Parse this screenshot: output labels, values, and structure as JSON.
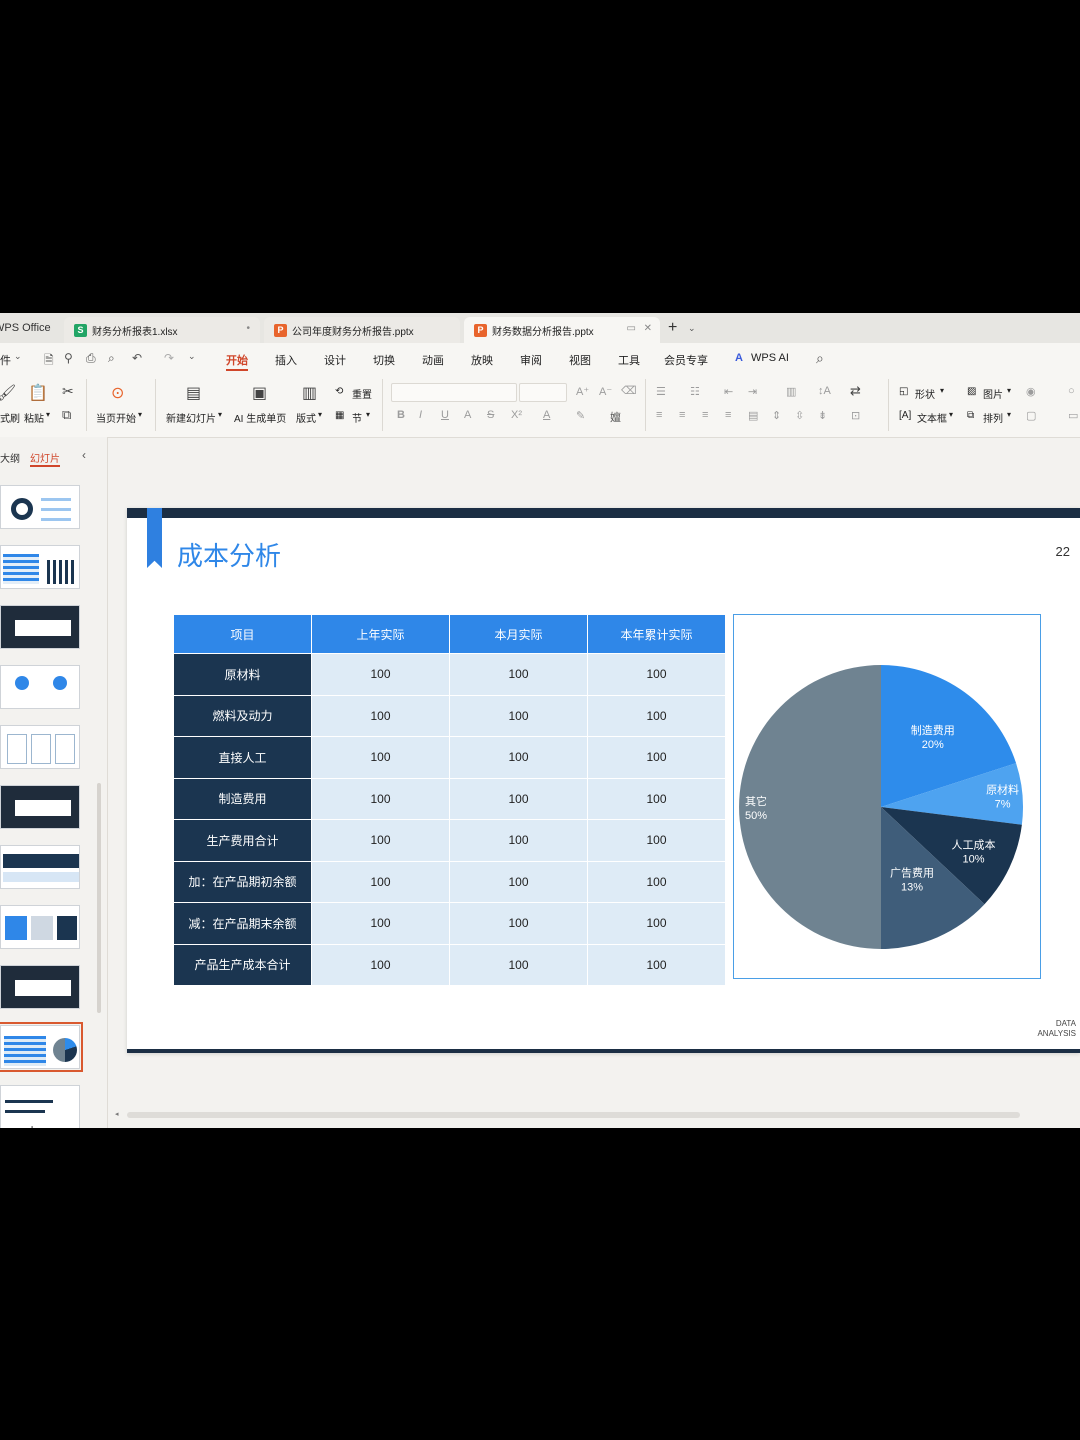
{
  "tabs": {
    "brand": "WPS Office",
    "items": [
      {
        "label": "财务分析报表1.xlsx",
        "icon": "S",
        "color": "#22a566"
      },
      {
        "label": "公司年度财务分析报告.pptx",
        "icon": "P",
        "color": "#e8642c"
      },
      {
        "label": "财务数据分析报告.pptx",
        "icon": "P",
        "color": "#e8642c"
      }
    ]
  },
  "menu": {
    "file": "件",
    "items": [
      "开始",
      "插入",
      "设计",
      "切换",
      "动画",
      "放映",
      "审阅",
      "视图",
      "工具",
      "会员专享"
    ],
    "active": "开始",
    "ai": "WPS AI"
  },
  "ribbon": {
    "format_painter": "式刷",
    "paste": "粘贴",
    "start_from_current": "当页开始",
    "new_slide": "新建幻灯片",
    "ai_page": "AI 生成单页",
    "layout": "版式",
    "reset": "重置",
    "section": "节",
    "shape": "形状",
    "picture": "图片",
    "textbox": "文本框",
    "arrange": "排列"
  },
  "panel": {
    "outline_tab": "大纲",
    "slides_tab": "幻灯片"
  },
  "slide": {
    "title": "成本分析",
    "page_number": "22",
    "brand_line1": "DATA",
    "brand_line2": "ANALYSIS",
    "table": {
      "headers": [
        "项目",
        "上年实际",
        "本月实际",
        "本年累计实际"
      ],
      "rows": [
        [
          "原材料",
          "100",
          "100",
          "100"
        ],
        [
          "燃料及动力",
          "100",
          "100",
          "100"
        ],
        [
          "直接人工",
          "100",
          "100",
          "100"
        ],
        [
          "制造费用",
          "100",
          "100",
          "100"
        ],
        [
          "生产费用合计",
          "100",
          "100",
          "100"
        ],
        [
          "加：在产品期初余额",
          "100",
          "100",
          "100"
        ],
        [
          "减：在产品期末余额",
          "100",
          "100",
          "100"
        ],
        [
          "产品生产成本合计",
          "100",
          "100",
          "100"
        ]
      ]
    }
  },
  "chart_data": {
    "type": "pie",
    "slices": [
      {
        "label": "制造费用",
        "pct": "20%",
        "value": 20,
        "color": "#2e8ceb"
      },
      {
        "label": "原材料",
        "pct": "7%",
        "value": 7,
        "color": "#4ea3f0"
      },
      {
        "label": "人工成本",
        "pct": "10%",
        "value": 10,
        "color": "#1b3550"
      },
      {
        "label": "广告费用",
        "pct": "13%",
        "value": 13,
        "color": "#3f5d7a"
      },
      {
        "label": "其它",
        "pct": "50%",
        "value": 50,
        "color": "#6f8391"
      }
    ]
  }
}
